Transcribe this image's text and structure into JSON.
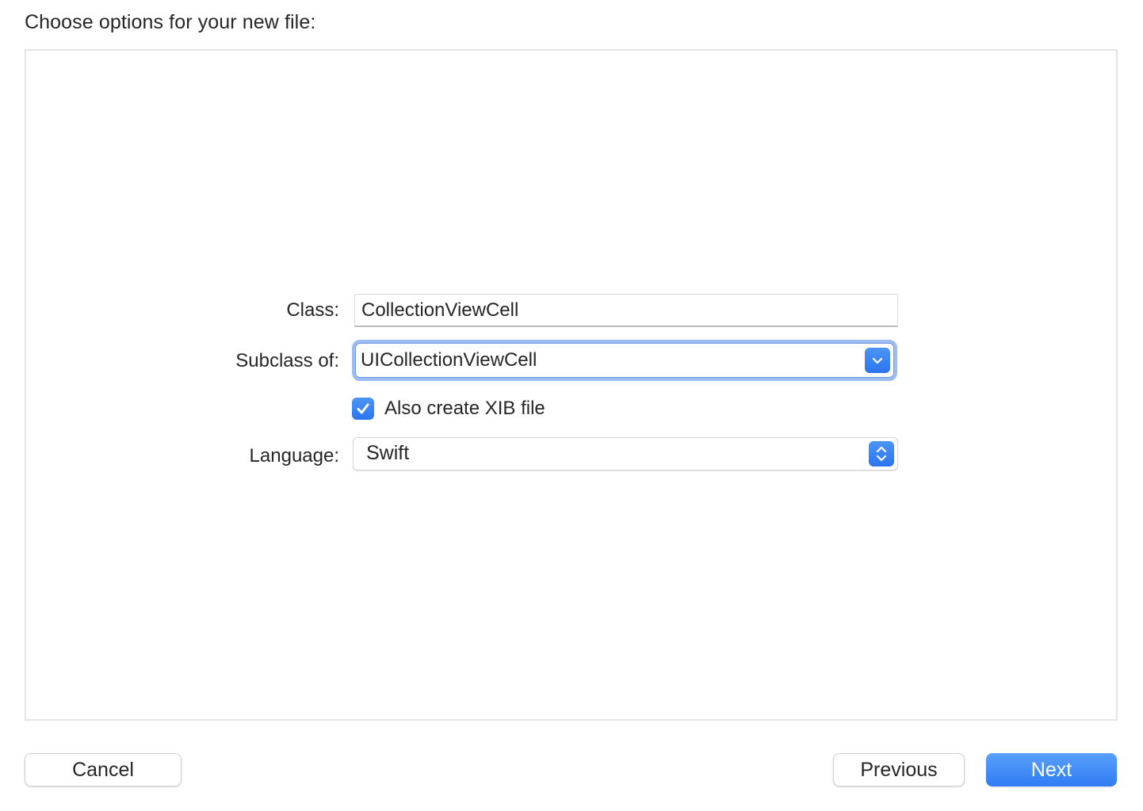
{
  "dialog": {
    "heading": "Choose options for your new file:"
  },
  "form": {
    "class_label": "Class:",
    "class_value": "CollectionViewCell",
    "subclass_label": "Subclass of:",
    "subclass_value": "UICollectionViewCell",
    "xib_label": "Also create XIB file",
    "xib_checked": true,
    "language_label": "Language:",
    "language_value": "Swift"
  },
  "footer": {
    "cancel_label": "Cancel",
    "previous_label": "Previous",
    "next_label": "Next"
  },
  "icons": {
    "subclass_popup": "chevron-down-icon",
    "language_popup": "up-down-chevron-icon",
    "checkbox": "checkmark-icon"
  },
  "colors": {
    "accent": "#2f7cf3",
    "focus_ring": "#9cbcf4"
  }
}
